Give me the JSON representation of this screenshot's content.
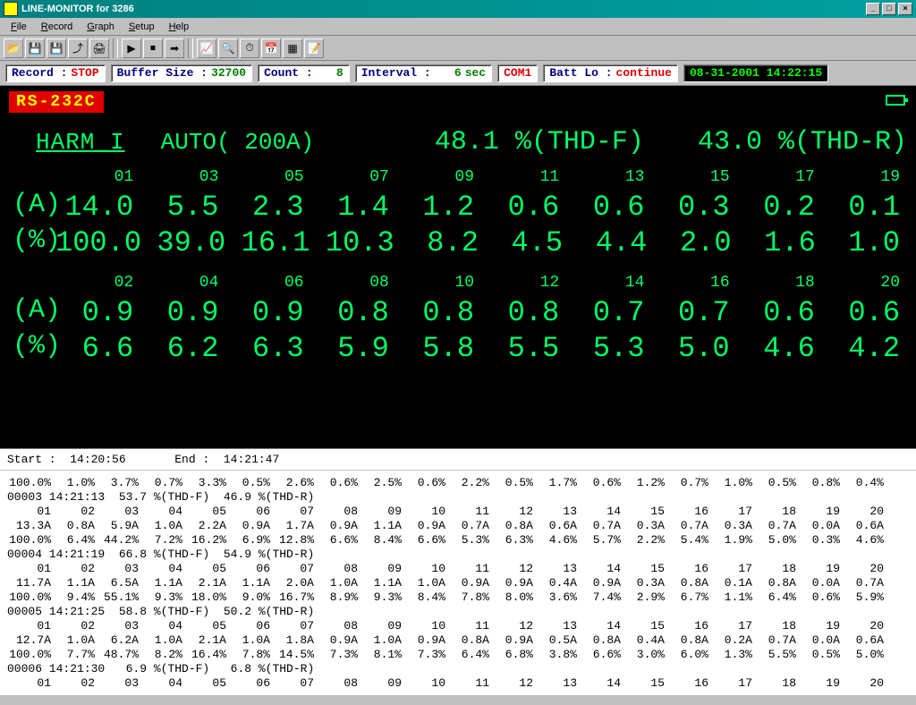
{
  "window": {
    "title": "LINE-MONITOR for 3286"
  },
  "menu": {
    "file": "File",
    "record": "Record",
    "graph": "Graph",
    "setup": "Setup",
    "help": "Help"
  },
  "status": {
    "record_label": "Record :",
    "record_value": "STOP",
    "buffer_label": "Buffer Size :",
    "buffer_value": "32700",
    "count_label": "Count :",
    "count_value": "8",
    "interval_label": "Interval :",
    "interval_value": "6",
    "interval_unit": "sec",
    "com": "COM1",
    "batt_label": "Batt Lo :",
    "batt_value": "continue",
    "datetime": "08-31-2001 14:22:15"
  },
  "display": {
    "rs232": "RS-232C",
    "mode": "HARM_I",
    "range": "AUTO( 200A)",
    "thdf_value": "48.1",
    "thdf_label": "%(THD-F)",
    "thdr_value": "43.0",
    "thdr_label": "%(THD-R)",
    "odd": {
      "headers": [
        "01",
        "03",
        "05",
        "07",
        "09",
        "11",
        "13",
        "15",
        "17",
        "19"
      ],
      "amps": [
        "14.0",
        "5.5",
        "2.3",
        "1.4",
        "1.2",
        "0.6",
        "0.6",
        "0.3",
        "0.2",
        "0.1"
      ],
      "pct": [
        "100.0",
        "39.0",
        "16.1",
        "10.3",
        "8.2",
        "4.5",
        "4.4",
        "2.0",
        "1.6",
        "1.0"
      ]
    },
    "even": {
      "headers": [
        "02",
        "04",
        "06",
        "08",
        "10",
        "12",
        "14",
        "16",
        "18",
        "20"
      ],
      "amps": [
        "0.9",
        "0.9",
        "0.9",
        "0.8",
        "0.8",
        "0.8",
        "0.7",
        "0.7",
        "0.6",
        "0.6"
      ],
      "pct": [
        "6.6",
        "6.2",
        "6.3",
        "5.9",
        "5.8",
        "5.5",
        "5.3",
        "5.0",
        "4.6",
        "4.2"
      ]
    },
    "row_A": "(A)",
    "row_P": "(%)"
  },
  "times": {
    "start_label": "Start :",
    "start_value": "14:20:56",
    "end_label": "End :",
    "end_value": "14:21:47"
  },
  "log_headers": [
    "01",
    "02",
    "03",
    "04",
    "05",
    "06",
    "07",
    "08",
    "09",
    "10",
    "11",
    "12",
    "13",
    "14",
    "15",
    "16",
    "17",
    "18",
    "19",
    "20"
  ],
  "log": [
    {
      "type": "pct",
      "cells": [
        "100.0%",
        "1.0%",
        "3.7%",
        "0.7%",
        "3.3%",
        "0.5%",
        "2.6%",
        "0.6%",
        "2.5%",
        "0.6%",
        "2.2%",
        "0.5%",
        "1.7%",
        "0.6%",
        "1.2%",
        "0.7%",
        "1.0%",
        "0.5%",
        "0.8%",
        "0.4%"
      ]
    },
    {
      "type": "rec",
      "text": "00003 14:21:13  53.7 %(THD-F)  46.9 %(THD-R)"
    },
    {
      "type": "hdr"
    },
    {
      "type": "amp",
      "cells": [
        "13.3A",
        "0.8A",
        "5.9A",
        "1.0A",
        "2.2A",
        "0.9A",
        "1.7A",
        "0.9A",
        "1.1A",
        "0.9A",
        "0.7A",
        "0.8A",
        "0.6A",
        "0.7A",
        "0.3A",
        "0.7A",
        "0.0A",
        "0.6A"
      ],
      "prefix": [
        "",
        ""
      ],
      "cells20": [
        "13.3A",
        "0.8A",
        "5.9A",
        "1.0A",
        "2.2A",
        "0.9A",
        "1.7A",
        "0.9A",
        "1.1A",
        "0.9A",
        "0.7A",
        "0.8A",
        "0.6A",
        "0.7A",
        "0.3A",
        "0.7A",
        "0.0A",
        "0.6A",
        "",
        ""
      ]
    },
    {
      "type": "row",
      "cells": [
        "13.3A",
        "0.8A",
        "5.9A",
        "1.0A",
        "2.2A",
        "0.9A",
        "1.7A",
        "0.9A",
        "1.1A",
        "0.9A",
        "0.7A",
        "0.8A",
        "0.6A",
        "0.7A",
        "0.3A",
        "0.7A",
        "0.3A",
        "0.7A",
        "0.0A",
        "0.6A"
      ]
    },
    {
      "type": "row",
      "cells": [
        "100.0%",
        "6.4%",
        "44.2%",
        "7.2%",
        "16.2%",
        "6.9%",
        "12.8%",
        "6.6%",
        "8.4%",
        "6.6%",
        "5.3%",
        "6.3%",
        "4.6%",
        "5.7%",
        "2.2%",
        "5.4%",
        "1.9%",
        "5.0%",
        "0.3%",
        "4.6%"
      ]
    },
    {
      "type": "rec",
      "text": "00004 14:21:19  66.8 %(THD-F)  54.9 %(THD-R)"
    },
    {
      "type": "hdr"
    },
    {
      "type": "row",
      "cells": [
        "11.7A",
        "1.1A",
        "6.5A",
        "1.1A",
        "2.1A",
        "1.1A",
        "2.0A",
        "1.0A",
        "1.1A",
        "1.0A",
        "0.9A",
        "0.9A",
        "0.4A",
        "0.9A",
        "0.3A",
        "0.8A",
        "0.1A",
        "0.8A",
        "0.0A",
        "0.7A"
      ]
    },
    {
      "type": "row",
      "cells": [
        "100.0%",
        "9.4%",
        "55.1%",
        "9.3%",
        "18.0%",
        "9.0%",
        "16.7%",
        "8.9%",
        "9.3%",
        "8.4%",
        "7.8%",
        "8.0%",
        "3.6%",
        "7.4%",
        "2.9%",
        "6.7%",
        "1.1%",
        "6.4%",
        "0.6%",
        "5.9%"
      ]
    },
    {
      "type": "rec",
      "text": "00005 14:21:25  58.8 %(THD-F)  50.2 %(THD-R)"
    },
    {
      "type": "hdr"
    },
    {
      "type": "row",
      "cells": [
        "12.7A",
        "1.0A",
        "6.2A",
        "1.0A",
        "2.1A",
        "1.0A",
        "1.8A",
        "0.9A",
        "1.0A",
        "0.9A",
        "0.8A",
        "0.9A",
        "0.5A",
        "0.8A",
        "0.4A",
        "0.8A",
        "0.2A",
        "0.7A",
        "0.0A",
        "0.6A"
      ]
    },
    {
      "type": "row",
      "cells": [
        "100.0%",
        "7.7%",
        "48.7%",
        "8.2%",
        "16.4%",
        "7.8%",
        "14.5%",
        "7.3%",
        "8.1%",
        "7.3%",
        "6.4%",
        "6.8%",
        "3.8%",
        "6.6%",
        "3.0%",
        "6.0%",
        "1.3%",
        "5.5%",
        "0.5%",
        "5.0%"
      ]
    },
    {
      "type": "rec",
      "text": "00006 14:21:30   6.9 %(THD-F)   6.8 %(THD-R)"
    },
    {
      "type": "hdr"
    }
  ]
}
